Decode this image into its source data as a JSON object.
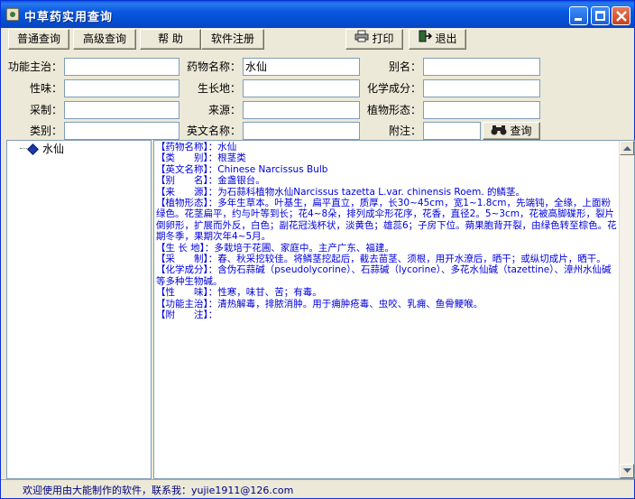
{
  "window": {
    "title": "中草药实用查询"
  },
  "toolbar": {
    "normal_query": "普通查询",
    "advanced_query": "高级查询",
    "help": "帮  助",
    "register": "软件注册",
    "print": "打印",
    "exit": "退出"
  },
  "form": {
    "function_label": "功能主治：",
    "function_value": "",
    "taste_label": "性味：",
    "taste_value": "",
    "harvest_label": "采制：",
    "harvest_value": "",
    "category_label": "类别：",
    "category_value": "",
    "drug_name_label": "药物名称：",
    "drug_name_value": "水仙",
    "habitat_label": "生长地：",
    "habitat_value": "",
    "source_label": "来源：",
    "source_value": "",
    "english_label": "英文名称：",
    "english_value": "",
    "alias_label": "别名：",
    "alias_value": "",
    "chem_label": "化学成分：",
    "chem_value": "",
    "morph_label": "植物形态：",
    "morph_value": "",
    "note_label": "附注：",
    "note_value": "",
    "search_button": "查询"
  },
  "tree": {
    "items": [
      "水仙"
    ]
  },
  "detail": {
    "text": "【药物名称】：水仙\n【类　　别】：根茎类\n【英文名称】：Chinese Narcissus Bulb\n【别　　名】：金盏银台。\n【来　　源】：为石蒜科植物水仙Narcissus tazetta L.var. chinensis Roem. 的鳞茎。\n【植物形态】：多年生草本。叶基生，扁平直立，质厚，长30~45cm，宽1~1.8cm，先端钝，全缘，上面粉绿色。花茎扁平，约与叶等到长；花4~8朵，排列成伞形花序，花香，直径2。5~3cm，花被高脚碟形，裂片倒卵形，扩展而外反，白色；副花冠浅杯状，淡黄色；雄蕊6；子房下位。蒴果胞背开裂，由绿色转至棕色。花期冬季，果期次年4~5月。\n【生 长 地】：多栽培于花圃、家庭中。主产广东、福建。\n【采　　制】：春、秋采挖较佳。将鳞茎挖起后，截去苗茎、须根，用开水潦后，晒干；或纵切成片，晒干。\n【化学成分】：含伪石蒜碱（pseudolycorine）、石蒜碱（lycorine）、多花水仙碱（tazettine）、漳州水仙碱等多种生物碱。\n【性　　味】：性寒，味甘、苦；有毒。\n【功能主治】：清热解毒，排脓消肿。用于痈肿疮毒、虫咬、乳痈、鱼骨鲠喉。\n【附　　注】："
  },
  "status": {
    "text": "欢迎使用由大能制作的软件，联系我：yujie1911@126.com"
  }
}
